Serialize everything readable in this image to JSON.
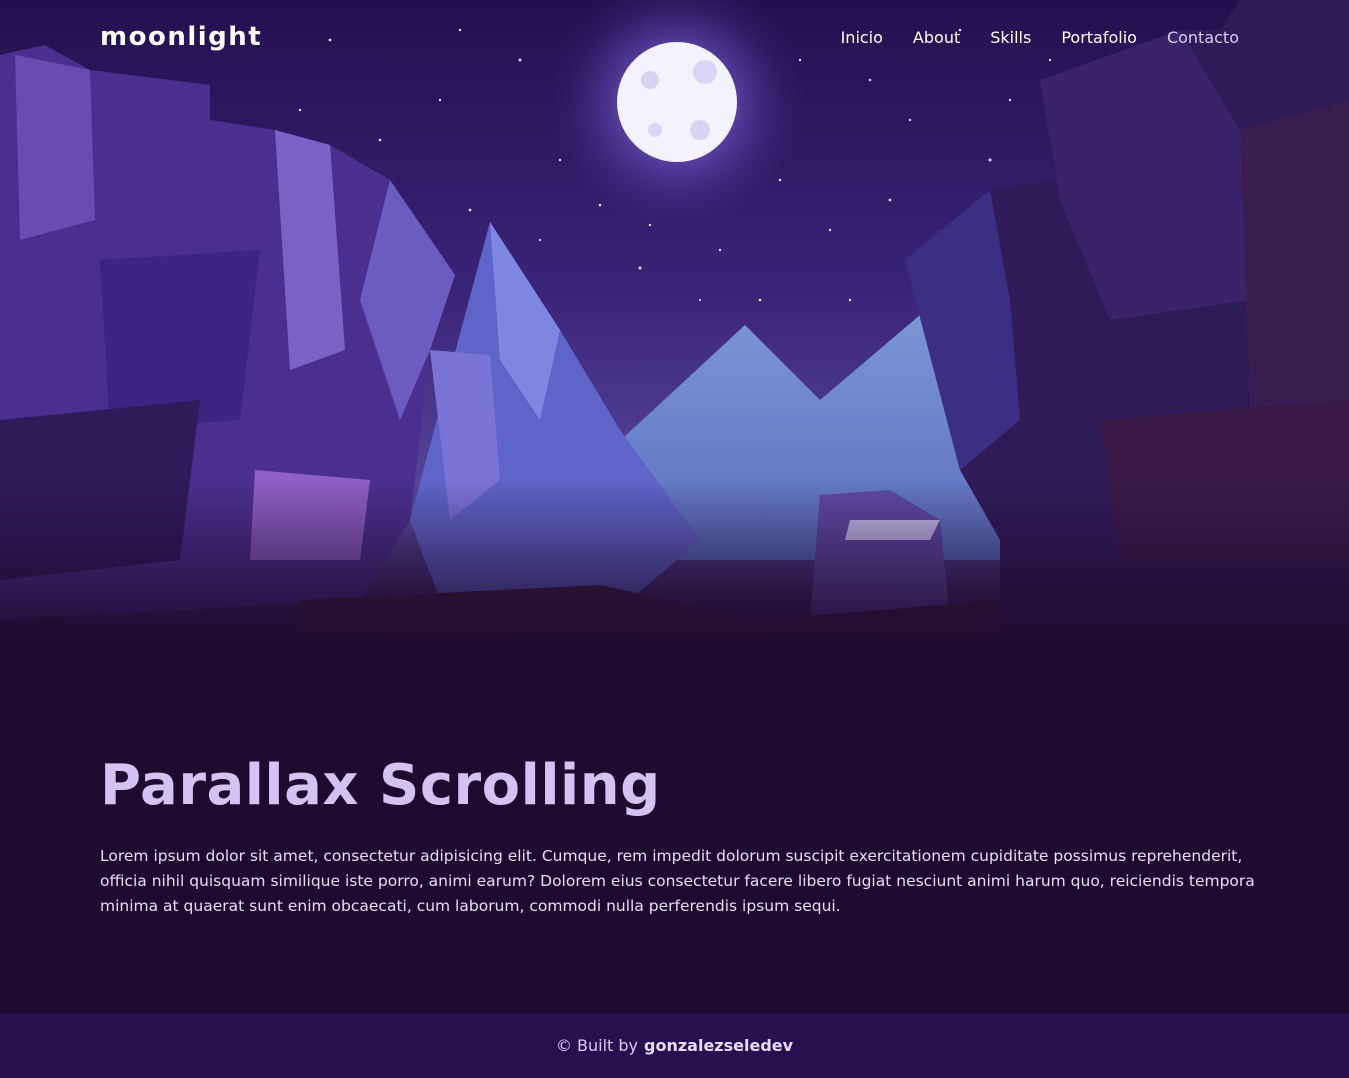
{
  "header": {
    "logo": "moonlight",
    "nav": [
      "Inicio",
      "About",
      "Skills",
      "Portafolio",
      "Contacto"
    ]
  },
  "main": {
    "title": "Parallax Scrolling",
    "body": "Lorem ipsum dolor sit amet, consectetur adipisicing elit. Cumque, rem impedit dolorum suscipit exercitationem cupiditate possimus reprehenderit, officia nihil quisquam similique iste porro, animi earum? Dolorem eius consectetur facere libero fugiat nesciunt animi harum quo, reiciendis tempora minima at quaerat sunt enim obcaecati, cum laborum, commodi nulla perferendis ipsum sequi."
  },
  "footer": {
    "prefix": "© Built by",
    "author": "gonzalezseledev"
  },
  "colors": {
    "background": "#1e0a2e",
    "sky": "#2b1660",
    "title": "#d4c2f2",
    "footer": "#281050"
  },
  "icons": [
    "moon-icon"
  ]
}
